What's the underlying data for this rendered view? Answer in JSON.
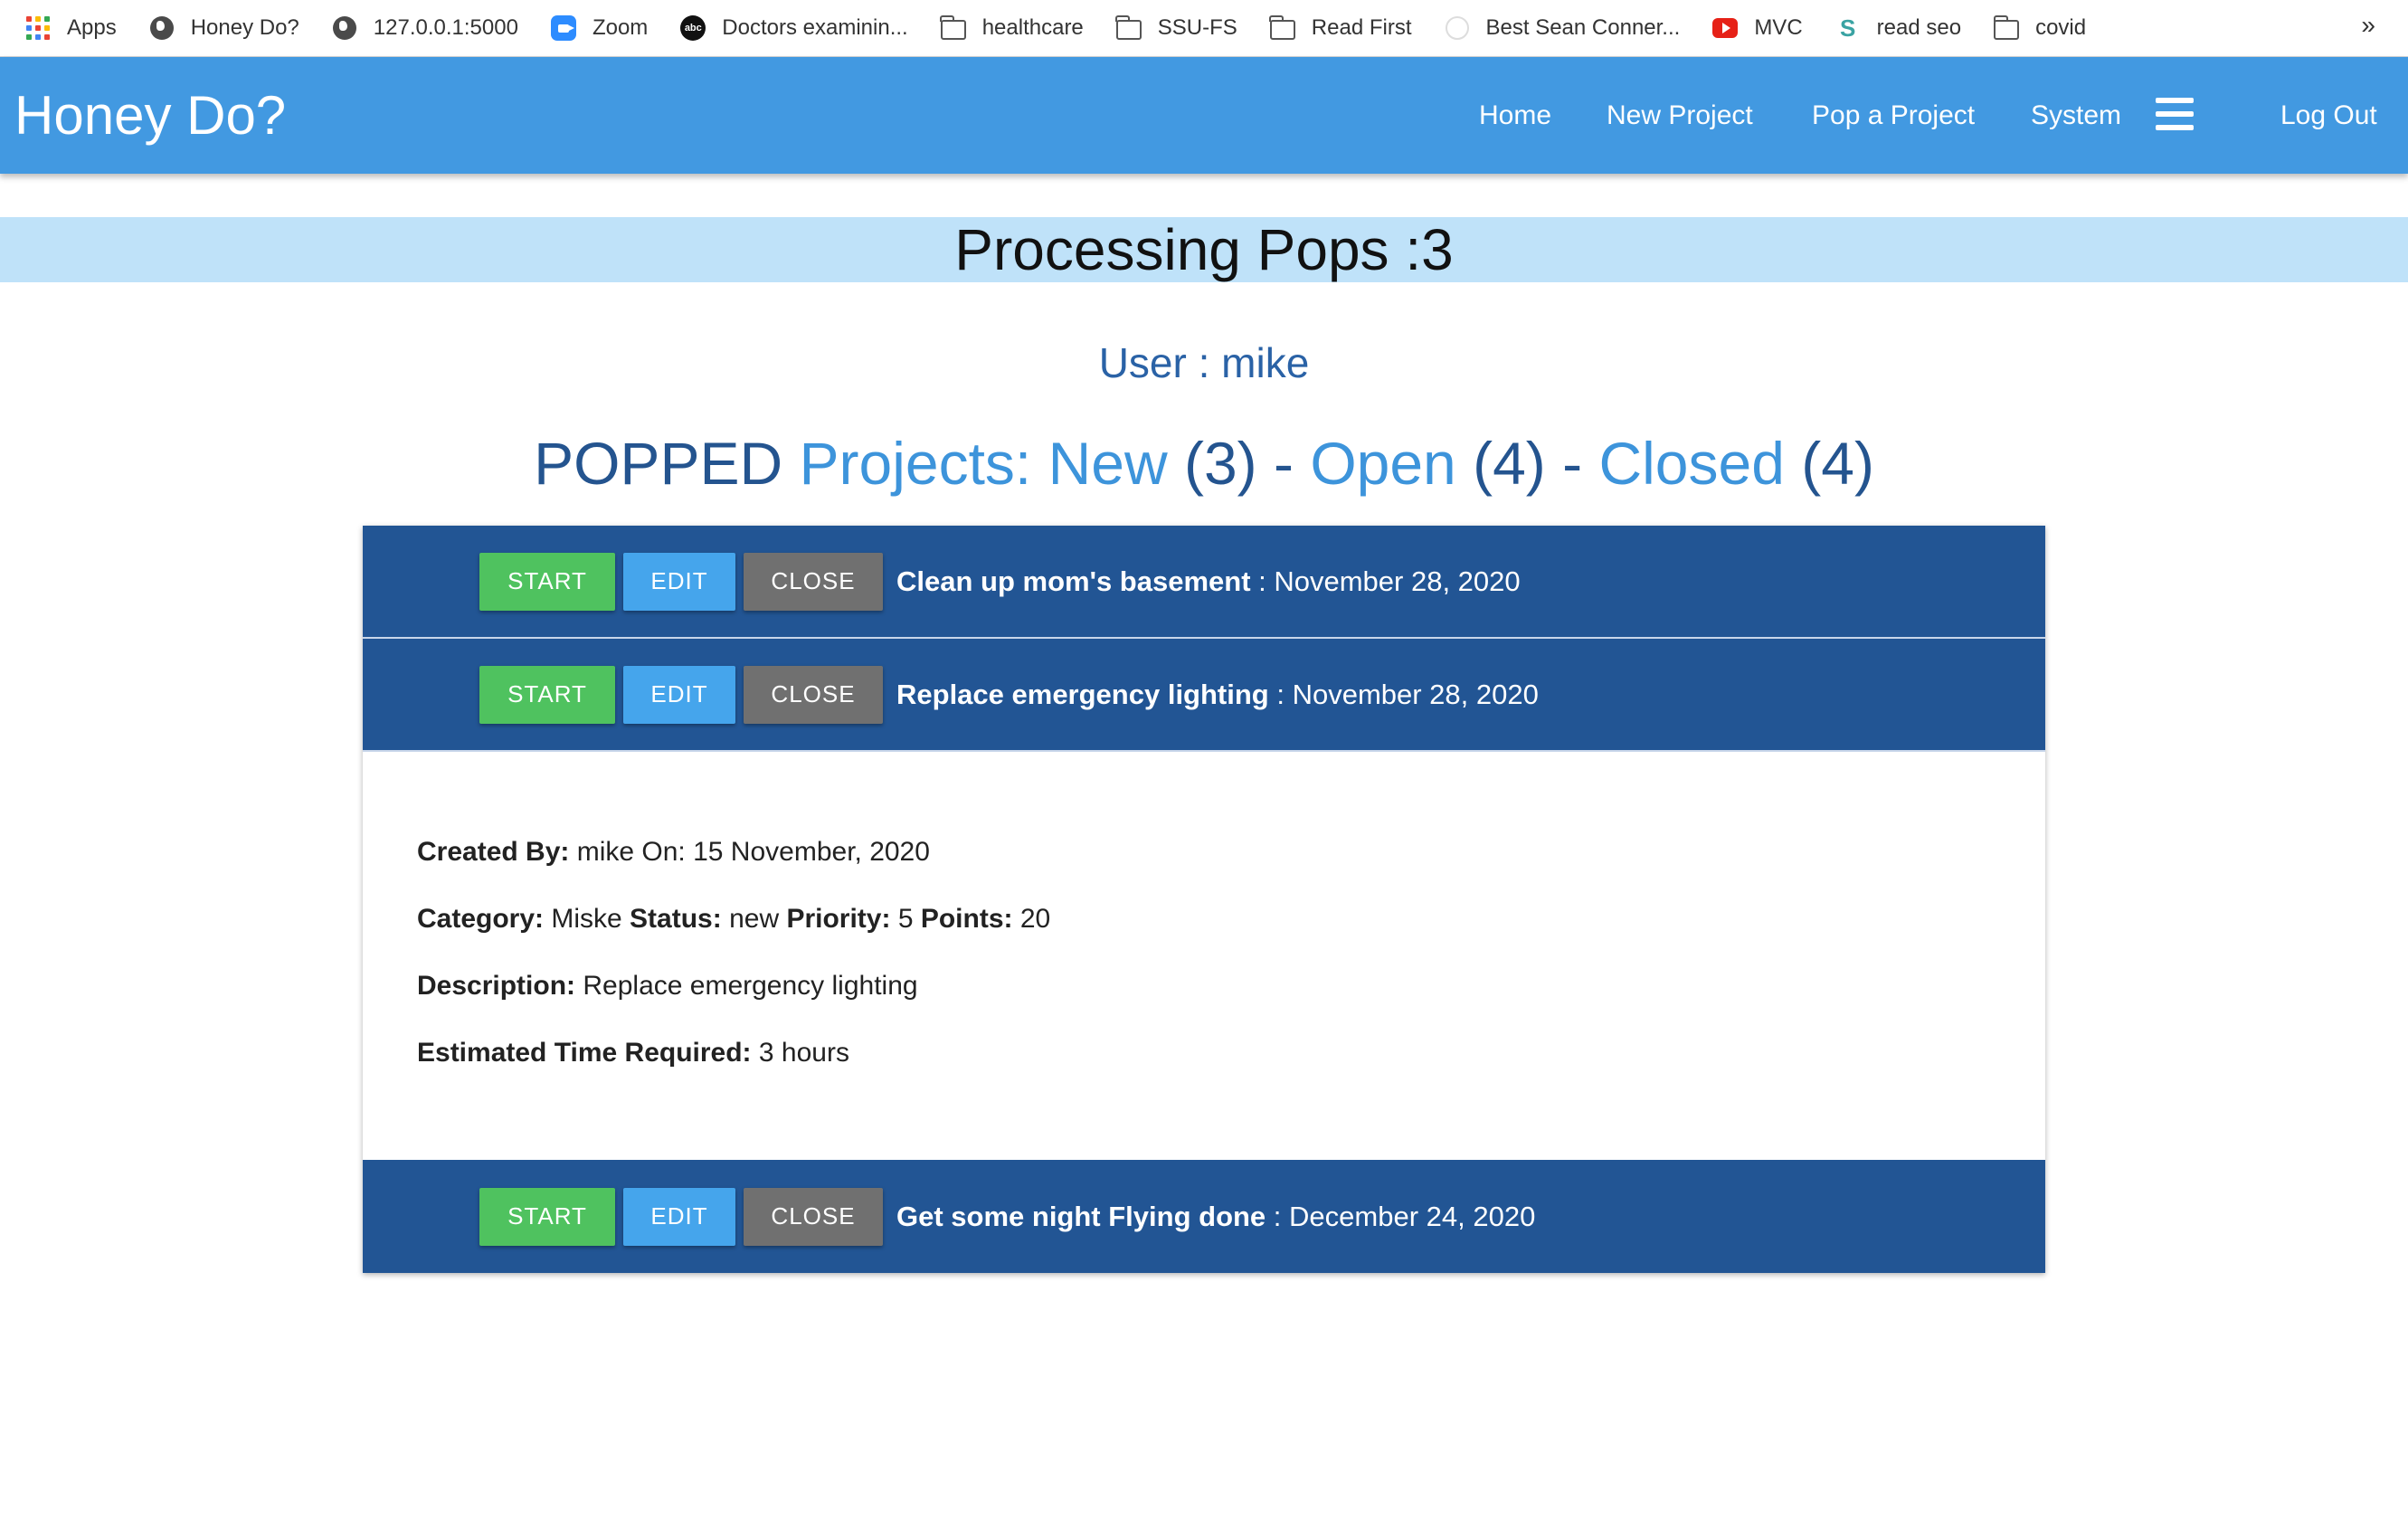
{
  "bookmarks": [
    {
      "label": "Apps",
      "icon": "apps-grid-icon"
    },
    {
      "label": "Honey Do?",
      "icon": "globe-icon"
    },
    {
      "label": "127.0.0.1:5000",
      "icon": "globe-icon"
    },
    {
      "label": "Zoom",
      "icon": "zoom-icon"
    },
    {
      "label": "Doctors examinin...",
      "icon": "abc-news-icon"
    },
    {
      "label": "healthcare",
      "icon": "folder-icon"
    },
    {
      "label": "SSU-FS",
      "icon": "folder-icon"
    },
    {
      "label": "Read First",
      "icon": "folder-icon"
    },
    {
      "label": "Best Sean Conner...",
      "icon": "nyt-icon"
    },
    {
      "label": "MVC",
      "icon": "youtube-icon"
    },
    {
      "label": "read seo",
      "icon": "s-icon"
    },
    {
      "label": "covid",
      "icon": "folder-icon"
    }
  ],
  "bookmarks_more": "»",
  "navbar": {
    "brand": "Honey Do?",
    "links": {
      "home": "Home",
      "new_project": "New Project",
      "pop_project": "Pop a Project",
      "system": "System",
      "logout": "Log Out"
    },
    "color": "#4299e1"
  },
  "page": {
    "title": "Processing Pops :3",
    "user_line": "User : mike",
    "summary": {
      "popped": "POPPED",
      "projects_new": "Projects: New",
      "new_count": "(3)",
      "sep1": "-",
      "open": "Open",
      "open_count": "(4)",
      "sep2": "-",
      "closed": "Closed",
      "closed_count": "(4)"
    }
  },
  "buttons": {
    "start": "START",
    "edit": "EDIT",
    "close": "CLOSE"
  },
  "projects": [
    {
      "name": "Clean up mom's basement",
      "date": " : November 28, 2020"
    },
    {
      "name": "Replace emergency lighting",
      "date": " : November 28, 2020"
    },
    {
      "name": "Get some night Flying done",
      "date": " : December 24, 2020"
    }
  ],
  "detail": {
    "created_by_label": "Created By:",
    "created_by_value": " mike On: 15 November, 2020",
    "category_label": "Category:",
    "category_value": " Miske ",
    "status_label": "Status:",
    "status_value": " new ",
    "priority_label": "Priority:",
    "priority_value": " 5 ",
    "points_label": "Points:",
    "points_value": " 20",
    "description_label": "Description:",
    "description_value": " Replace emergency lighting",
    "estimate_label": "Estimated Time Required:",
    "estimate_value": " 3 hours"
  },
  "colors": {
    "row": "#225594",
    "start": "#4fc25f",
    "edit": "#45a5ec",
    "close": "#707070",
    "band": "#bfe2f9"
  }
}
